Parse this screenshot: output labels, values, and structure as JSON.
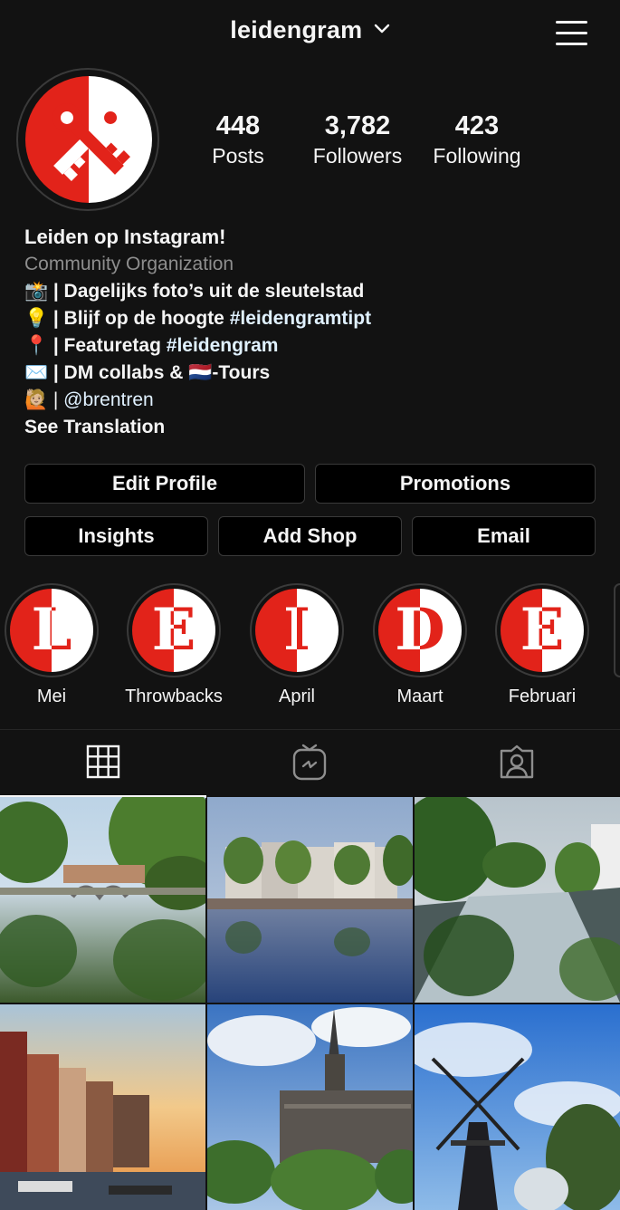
{
  "header": {
    "username": "leidengram"
  },
  "stats": [
    {
      "value": "448",
      "label": "Posts"
    },
    {
      "value": "3,782",
      "label": "Followers"
    },
    {
      "value": "423",
      "label": "Following"
    }
  ],
  "bio": {
    "name": "Leiden op Instagram!",
    "category": "Community Organization",
    "line1_emoji": "📸",
    "line1_text": "| Dagelijks foto’s uit de sleutelstad",
    "line2_emoji": "💡",
    "line2_text": "| Blijf op de hoogte",
    "line2_tag": "#leidengramtipt",
    "line3_emoji": "📍",
    "line3_text": "| Featuretag",
    "line3_tag": "#leidengram",
    "line4_emoji": "✉️",
    "line4_text": "| DM collabs &",
    "line4_flag": "🇳🇱",
    "line4_text2": "-Tours",
    "line5_emoji": "🙋🏼",
    "line5_text": "|",
    "line5_link": "@brentren",
    "see_translation": "See Translation"
  },
  "buttons": {
    "edit_profile": "Edit Profile",
    "promotions": "Promotions",
    "insights": "Insights",
    "add_shop": "Add Shop",
    "email": "Email"
  },
  "highlights": [
    {
      "letter": "L",
      "label": "Mei"
    },
    {
      "letter": "E",
      "label": "Throwbacks"
    },
    {
      "letter": "I",
      "label": "April"
    },
    {
      "letter": "D",
      "label": "Maart"
    },
    {
      "letter": "E",
      "label": "Februari"
    }
  ],
  "tabs": [
    {
      "icon": "grid-icon",
      "active": true
    },
    {
      "icon": "igtv-icon",
      "active": false
    },
    {
      "icon": "tagged-icon",
      "active": false
    }
  ],
  "colors": {
    "background": "#121212",
    "brand_red": "#e2231a",
    "link": "#e0f1ff",
    "muted": "#8e8e8e"
  },
  "posts": [
    {
      "scene": "canal-with-bridge-and-trees"
    },
    {
      "scene": "canal-houses-reflection"
    },
    {
      "scene": "tree-lined-canal"
    },
    {
      "scene": "sunset-canal-houses"
    },
    {
      "scene": "church-tower-under-clouds"
    },
    {
      "scene": "windmill-blue-sky"
    }
  ]
}
